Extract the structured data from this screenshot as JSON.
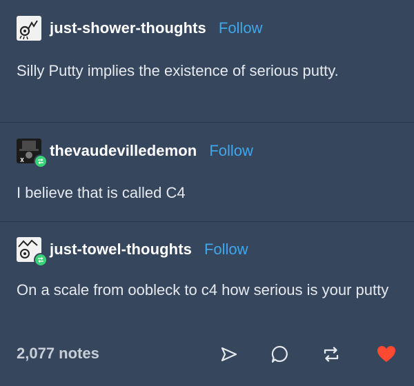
{
  "posts": [
    {
      "username": "just-shower-thoughts",
      "follow_label": "Follow",
      "text": "Silly Putty implies the existence of serious putty."
    },
    {
      "username": "thevaudevilledemon",
      "follow_label": "Follow",
      "text": "I believe that is called C4"
    },
    {
      "username": "just-towel-thoughts",
      "follow_label": "Follow",
      "text": "On a scale from oobleck to c4 how serious is your putty"
    }
  ],
  "footer": {
    "notes": "2,077 notes",
    "icons": [
      "share-icon",
      "reply-icon",
      "reblog-icon",
      "like-icon"
    ]
  },
  "colors": {
    "background": "#36465d",
    "follow": "#3ea8ec",
    "reblog_badge": "#3ad377",
    "like": "#ff4930"
  }
}
